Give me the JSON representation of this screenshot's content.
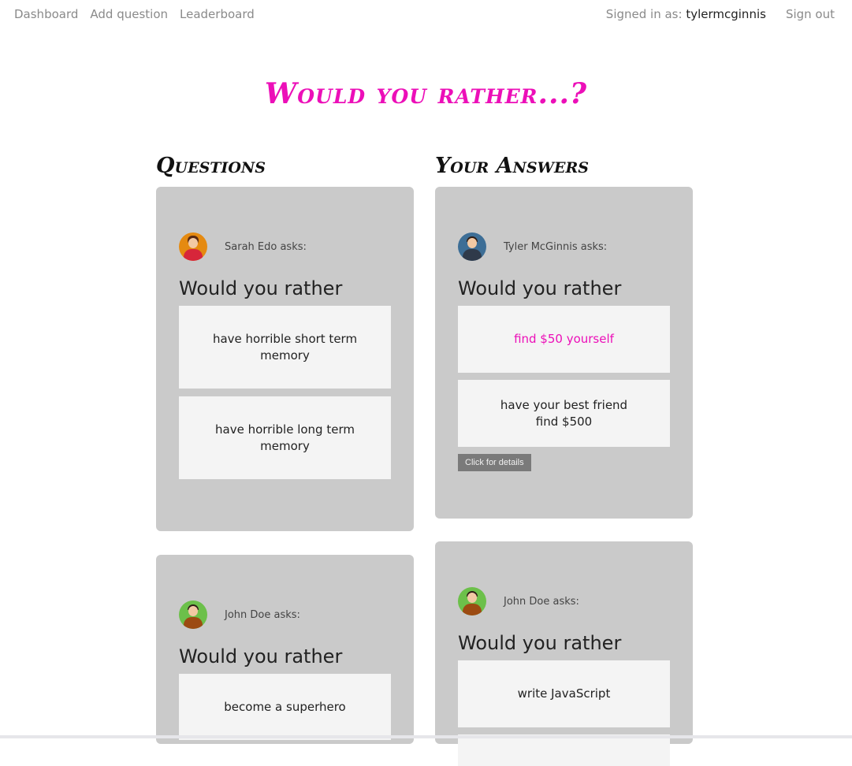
{
  "nav": {
    "links": [
      "Dashboard",
      "Add question",
      "Leaderboard"
    ],
    "signed_in_prefix": "Signed in as:",
    "username": "tylermcginnis",
    "sign_out": "Sign out"
  },
  "title": "Would you rather...?",
  "columns": {
    "questions": "Questions",
    "answers": "Your Answers"
  },
  "questions": [
    {
      "asker": "Sarah Edo asks:",
      "heading": "Would you rather",
      "options": [
        "have horrible short term memory",
        "have horrible long term memory"
      ]
    },
    {
      "asker": "John Doe asks:",
      "heading": "Would you rather",
      "options": [
        "become a superhero"
      ]
    }
  ],
  "answers": [
    {
      "asker": "Tyler McGinnis asks:",
      "heading": "Would you rather",
      "options": [
        "find $50 yourself",
        "have your best friend find $500"
      ],
      "details": "Click for details"
    },
    {
      "asker": "John Doe asks:",
      "heading": "Would you rather",
      "options": [
        "write JavaScript"
      ]
    }
  ],
  "colors": {
    "accent": "#ec0fb8",
    "card": "#cacaca",
    "option": "#f4f4f4"
  },
  "avatars": {
    "sarah": "woman-avatar-icon",
    "tyler": "man-avatar-icon",
    "john": "man-avatar-icon"
  }
}
